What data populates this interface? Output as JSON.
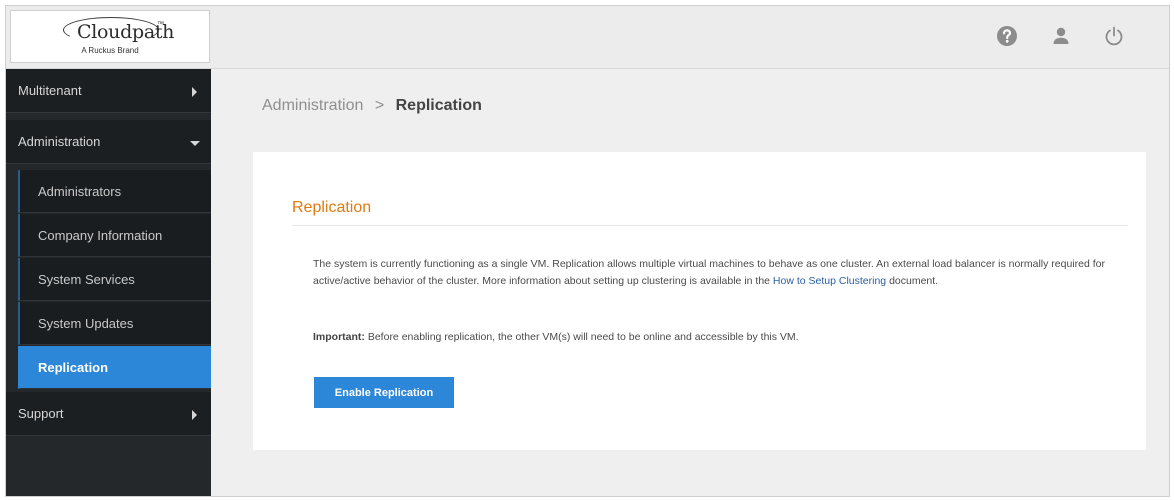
{
  "brand": {
    "name": "Cloudpath",
    "tm": "™",
    "tagline": "A Ruckus Brand"
  },
  "topbar": {
    "icons": [
      "help-icon",
      "user-icon",
      "power-icon"
    ]
  },
  "sidebar": {
    "items": [
      {
        "label": "Multitenant"
      },
      {
        "label": "Administration"
      },
      {
        "label": "Support"
      }
    ],
    "subitems": [
      {
        "label": "Administrators"
      },
      {
        "label": "Company Information"
      },
      {
        "label": "System Services"
      },
      {
        "label": "System Updates"
      },
      {
        "label": "Replication"
      }
    ]
  },
  "breadcrumb": {
    "parent": "Administration",
    "separator": ">",
    "current": "Replication"
  },
  "content": {
    "title": "Replication",
    "description_before_link": "The system is currently functioning as a single VM. Replication allows multiple virtual machines to behave as one cluster. An external load balancer is normally required for active/active behavior of the cluster. More information about setting up clustering is available in the ",
    "link_text": "How to Setup Clustering",
    "description_after_link": " document.",
    "important_label": "Important:",
    "important_text": " Before enabling replication, the other VM(s) will need to be online and accessible by this VM.",
    "button_label": "Enable Replication"
  },
  "colors": {
    "accent": "#2d87d8",
    "title_orange": "#e07b12",
    "sidebar_bg": "#25282b",
    "link": "#2a5fa3"
  }
}
